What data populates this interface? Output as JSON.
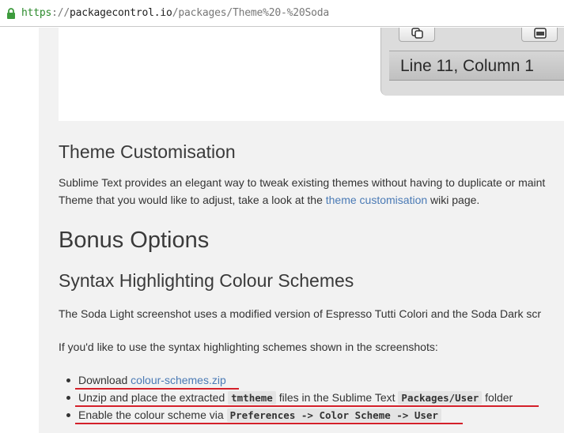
{
  "browser": {
    "url_scheme": "https",
    "url_sep": "://",
    "url_host": "packagecontrol.io",
    "url_path": "/packages/Theme%20-%20Soda"
  },
  "screenshot": {
    "status_text": "Line 11, Column 1"
  },
  "theme_section": {
    "heading": "Theme Customisation",
    "para_line1": "Sublime Text provides an elegant way to tweak existing themes without having to duplicate or maint",
    "para_line2_pre": "Theme that you would like to adjust, take a look at the ",
    "para_link": "theme customisation",
    "para_line2_post": " wiki page."
  },
  "bonus_section": {
    "heading": "Bonus Options",
    "subheading": "Syntax Highlighting Colour Schemes",
    "para1": "The Soda Light screenshot uses a modified version of Espresso Tutti Colori and the Soda Dark scr",
    "para2": "If you'd like to use the syntax highlighting schemes shown in the screenshots:",
    "items": [
      {
        "pre": "Download ",
        "link": "colour-schemes.zip"
      },
      {
        "pre": "Unzip and place the extracted ",
        "code1": "tmtheme",
        "mid": " files in the Sublime Text ",
        "code2": "Packages/User",
        "post": " folder"
      },
      {
        "pre": "Enable the colour scheme via ",
        "code1": "Preferences -> Color Scheme -> User"
      }
    ]
  },
  "colors": {
    "link": "#4a7ab5",
    "annotation_underline": "#d4202a",
    "page_background": "#f2f2f2",
    "secure_lock": "#3d9b3d"
  }
}
